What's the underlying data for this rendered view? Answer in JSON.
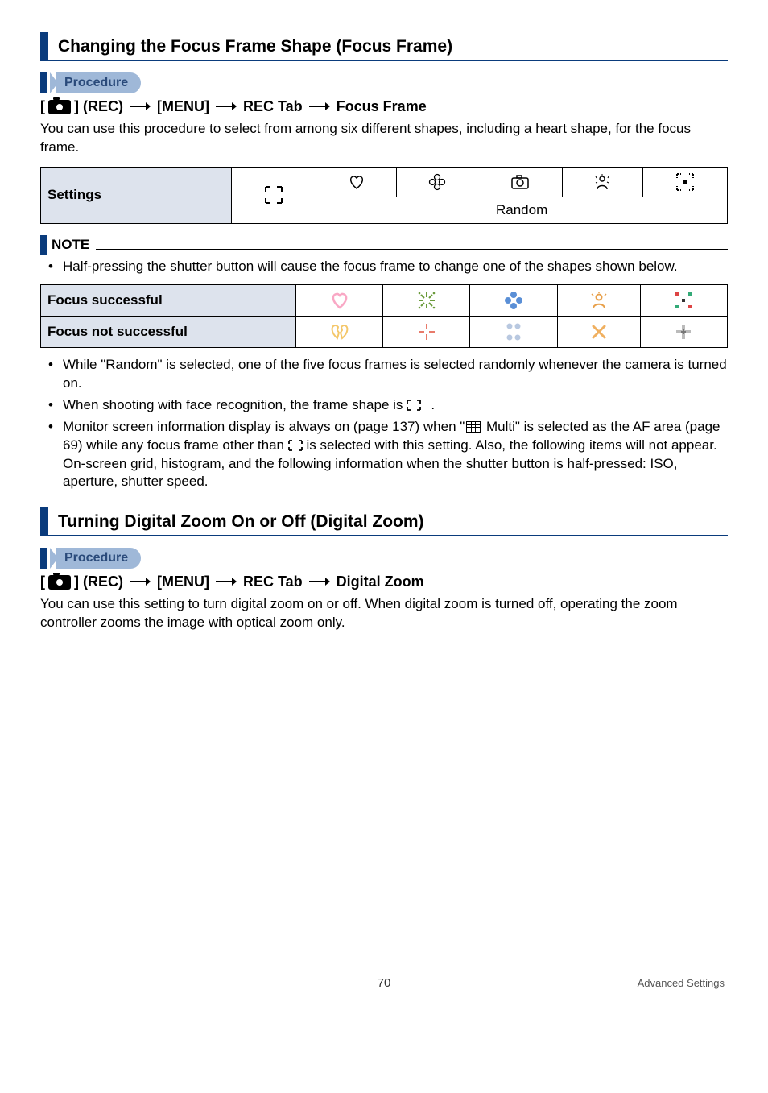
{
  "section1": {
    "title": "Changing the Focus Frame Shape (Focus Frame)",
    "procedure_label": "Procedure",
    "path_prefix": "[",
    "path_rec": "] (REC)",
    "path_menu": "[MENU]",
    "path_tab": "REC Tab",
    "path_item": "Focus Frame",
    "body": "You can use this procedure to select from among six different shapes, including a heart shape, for the focus frame.",
    "settings_label": "Settings",
    "random_label": "Random"
  },
  "note": {
    "label": "NOTE",
    "bullet1": "Half-pressing the shutter button will cause the focus frame to change one of the shapes shown below.",
    "row1_label": "Focus successful",
    "row2_label": "Focus not successful",
    "bullet2": "While \"Random\" is selected, one of the five focus frames is selected randomly whenever the camera is turned on.",
    "bullet3_a": "When shooting with face recognition, the frame shape is ",
    "bullet3_b": ".",
    "bullet4_a": "Monitor screen information display is always on (page 137) when \"",
    "bullet4_b": " Multi\" is selected as the AF area (page 69) while any focus frame other than ",
    "bullet4_c": " is selected with this setting. Also, the following items will not appear.",
    "bullet4_d": "On-screen grid, histogram, and the following information when the shutter button is half-pressed: ISO, aperture, shutter speed."
  },
  "section2": {
    "title": "Turning Digital Zoom On or Off (Digital Zoom)",
    "procedure_label": "Procedure",
    "path_prefix": "[",
    "path_rec": "] (REC)",
    "path_menu": "[MENU]",
    "path_tab": "REC Tab",
    "path_item": "Digital Zoom",
    "body": "You can use this setting to turn digital zoom on or off. When digital zoom is turned off, operating the zoom controller zooms the image with optical zoom only."
  },
  "footer": {
    "page": "70",
    "section": "Advanced Settings"
  }
}
